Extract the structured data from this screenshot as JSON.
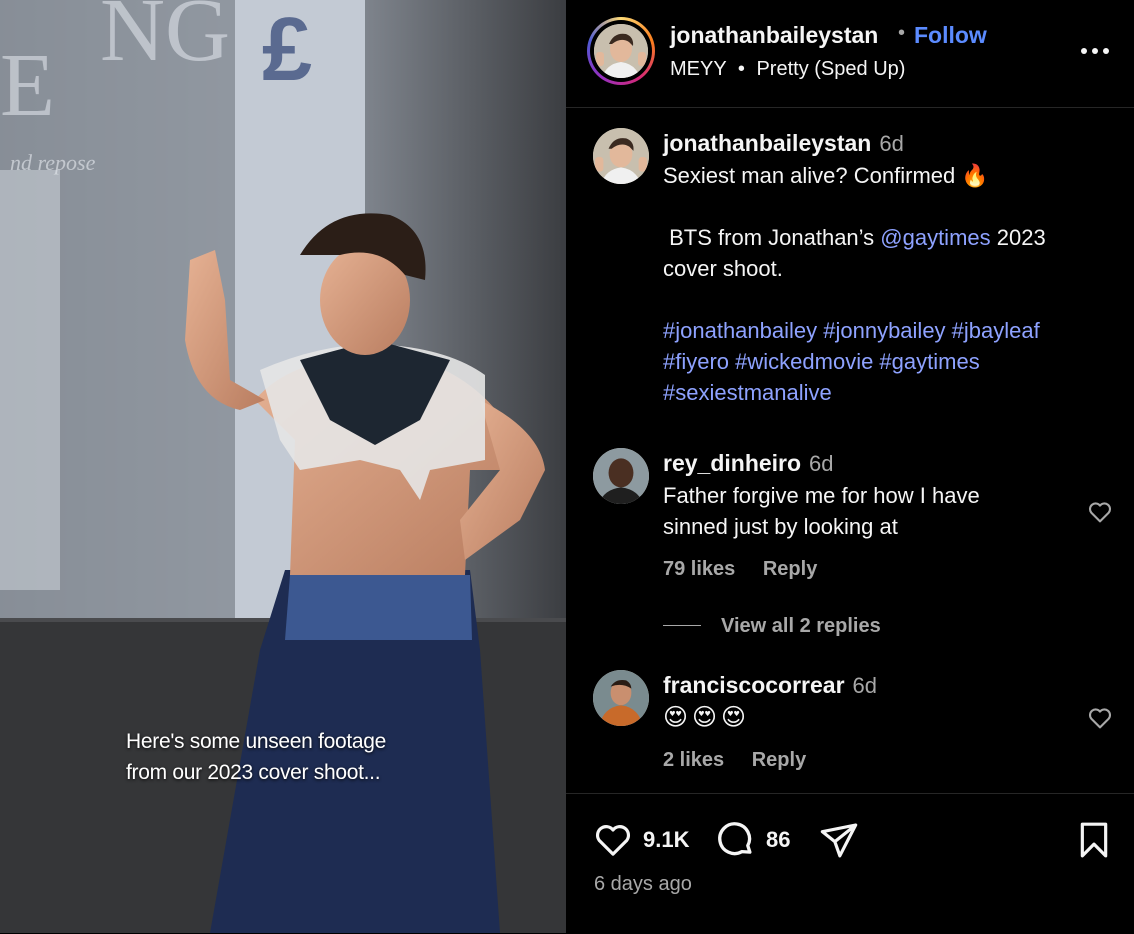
{
  "media": {
    "caption_line1": "Here's some unseen footage",
    "caption_line2": "from our 2023 cover shoot..."
  },
  "header": {
    "username": "jonathanbaileystan",
    "separator": "•",
    "follow_label": "Follow",
    "audio_artist": "MEYY",
    "audio_separator": "•",
    "audio_track": "Pretty (Sped Up)"
  },
  "post": {
    "username": "jonathanbaileystan",
    "time": "6d",
    "line1": "Sexiest man alive? Confirmed 🔥",
    "line2_prefix": "BTS from Jonathan’s ",
    "line2_mention": "@gaytimes",
    "line2_suffix": " 2023",
    "line3": "cover shoot.",
    "hashtags_line1": "#jonathanbailey #jonnybailey #jbayleaf",
    "hashtags_line2": "#fiyero #wickedmovie #gaytimes",
    "hashtags_line3": "#sexiestmanalive"
  },
  "comments": [
    {
      "username": "rey_dinheiro",
      "time": "6d",
      "line1": "Father forgive me for how I have",
      "line2": "sinned just by looking at",
      "likes": "79 likes",
      "reply_label": "Reply",
      "view_replies": "View all 2 replies"
    },
    {
      "username": "franciscocorrear",
      "time": "6d",
      "line1": "😍😍😍",
      "likes": "2 likes",
      "reply_label": "Reply"
    }
  ],
  "footer": {
    "likes_count": "9.1K",
    "comments_count": "86",
    "timestamp": "6 days ago"
  },
  "icons": {
    "like": "heart-icon",
    "comment": "comment-bubble-icon",
    "share": "paper-plane-icon",
    "save": "bookmark-icon",
    "more": "more-options-icon"
  },
  "colors": {
    "link": "#8ea2ff",
    "follow": "#5b8bff",
    "muted": "#a8a8a8",
    "background": "#000000"
  }
}
